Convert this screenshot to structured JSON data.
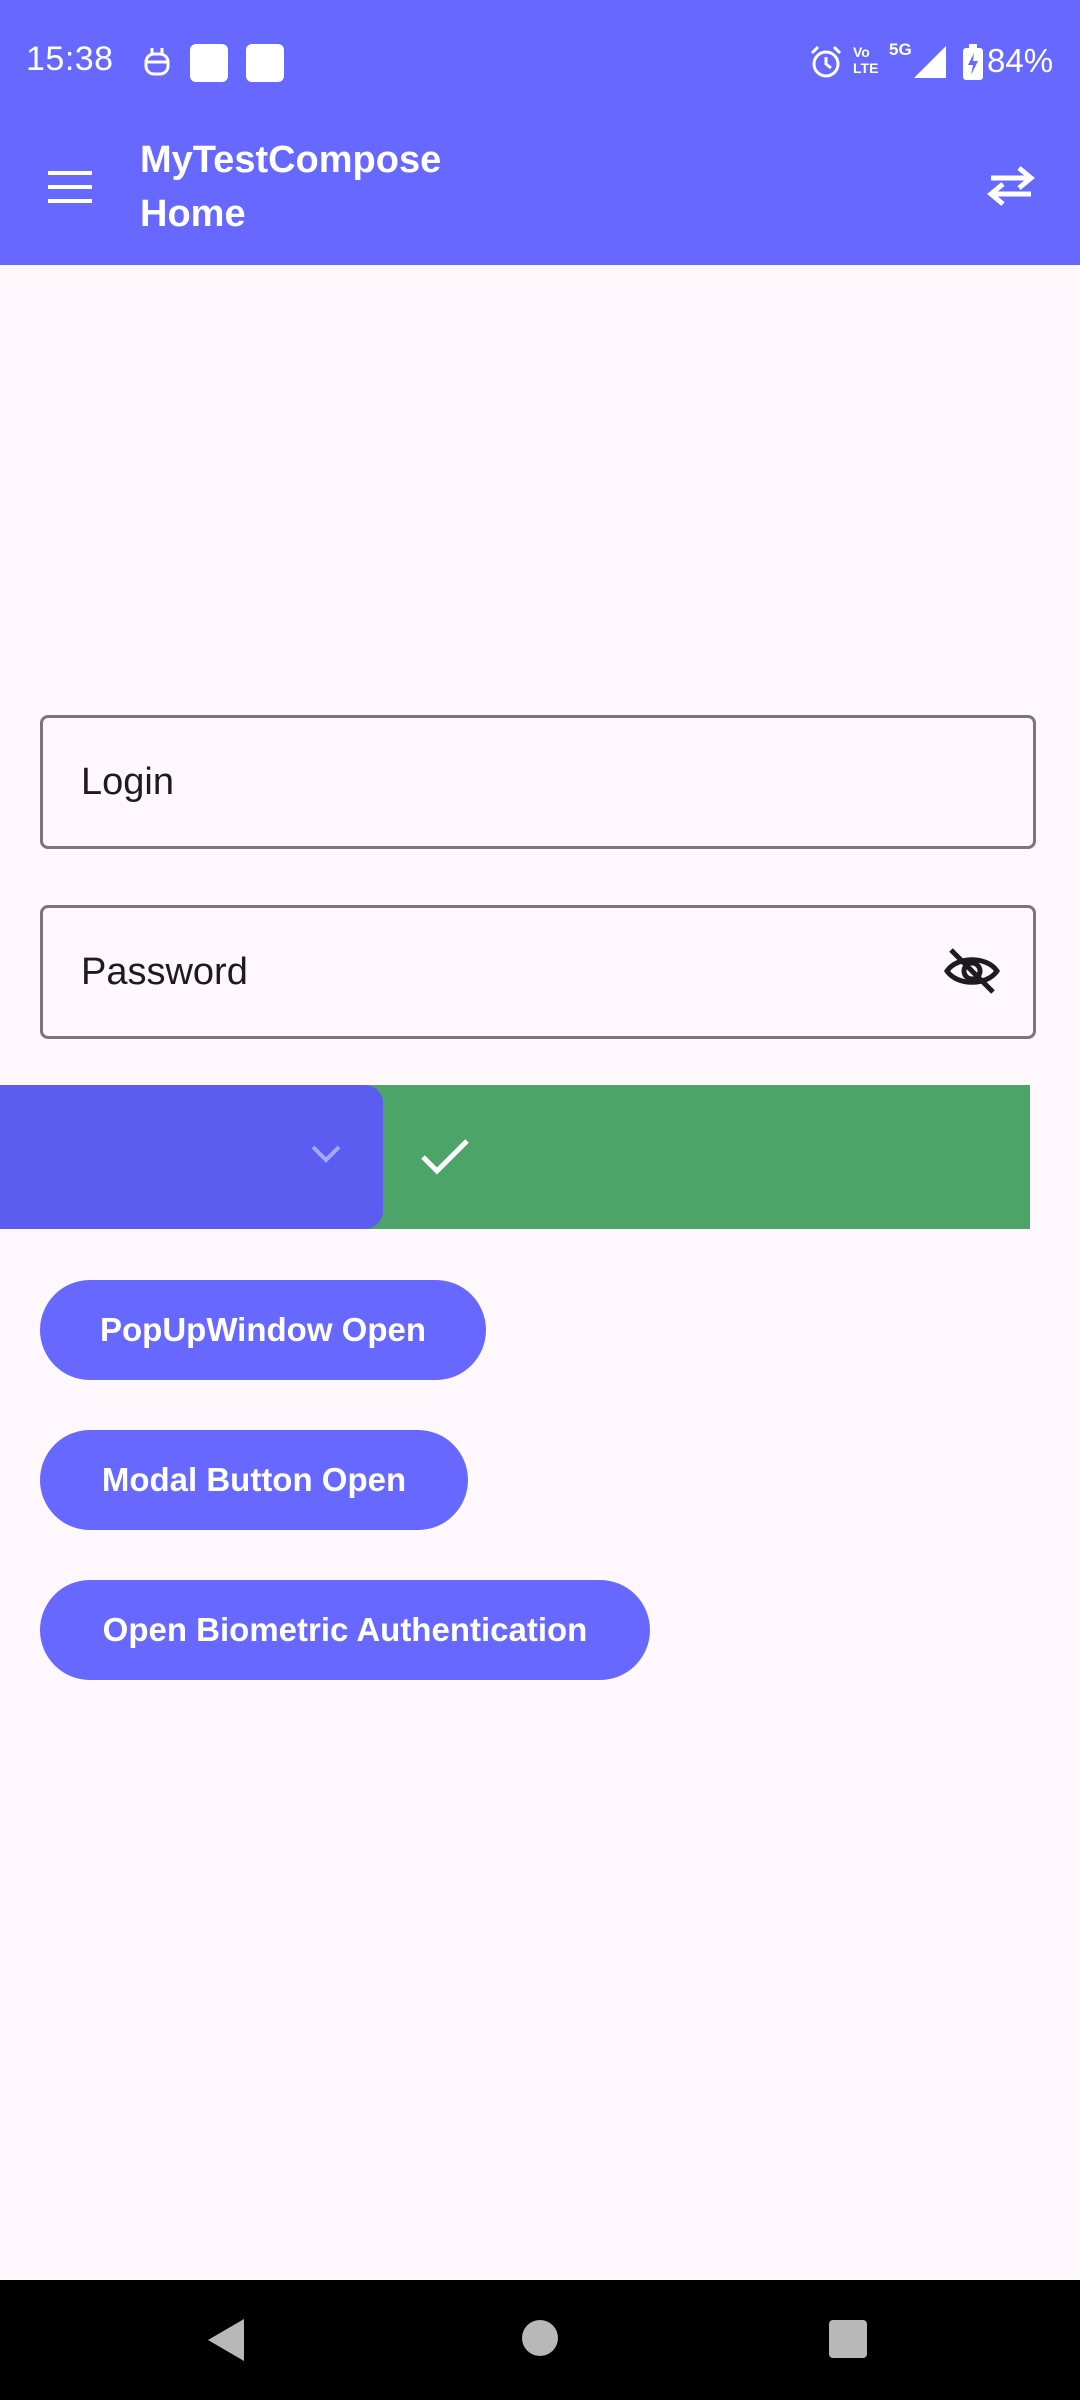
{
  "status_bar": {
    "time": "15:38",
    "icons": [
      "notification-app-icon",
      "square-notification-icon",
      "square-notification-icon",
      "alarm-icon",
      "volte-icon",
      "5g-signal-icon",
      "battery-charging-icon"
    ],
    "network_label_top": "Vo",
    "network_label_bottom": "LTE",
    "network_type": "5G",
    "battery": "84%"
  },
  "app_bar": {
    "title_line1": "MyTestCompose",
    "title_line2": "Home",
    "menu_icon": "hamburger-menu-icon",
    "action_icon": "swap-horiz-icon"
  },
  "form": {
    "login_label": "Login",
    "password_label": "Password",
    "password_toggle_icon": "visibility-off-icon"
  },
  "swipe_row": {
    "collapse_icon": "chevron-down-icon",
    "confirm_icon": "check-icon"
  },
  "buttons": {
    "popup": "PopUpWindow Open",
    "modal": "Modal Button Open",
    "biometric": "Open Biometric Authentication"
  },
  "colors": {
    "primary": "#6668FF",
    "swipe_blue": "#5B5CF0",
    "success_green": "#4CA468",
    "background": "#FEF7FC",
    "outline": "#7A757F"
  },
  "nav_bar": {
    "icons": [
      "back-triangle-icon",
      "home-circle-icon",
      "recents-square-icon"
    ]
  }
}
